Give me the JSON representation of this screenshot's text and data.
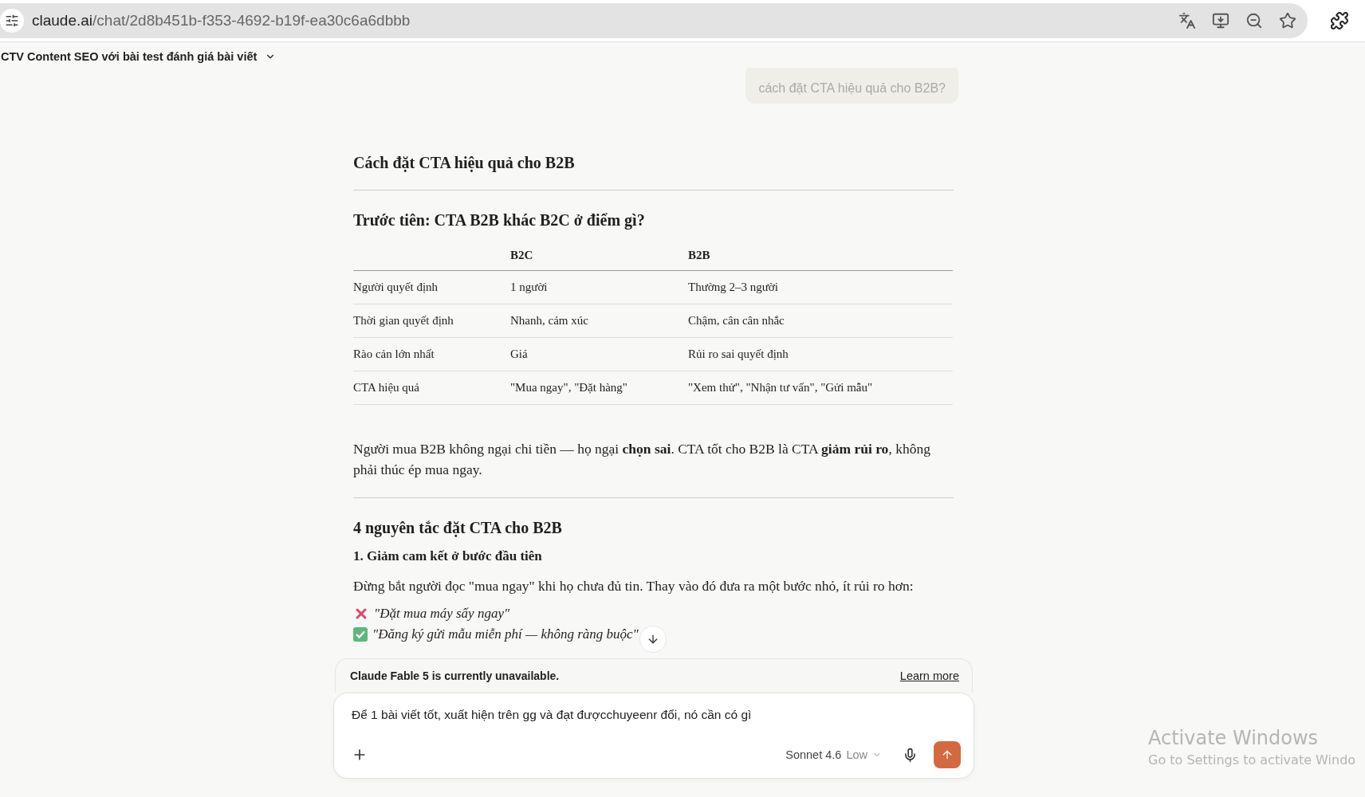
{
  "browser": {
    "url_host": "claude.ai",
    "url_path": "/chat/2d8b451b-f353-4692-b19f-ea30c6a6dbbb"
  },
  "conversation_title": "CTV Content SEO với bài test đánh giá bài viết",
  "user_message": "cách đặt CTA hiệu quả cho B2B?",
  "response": [
    {
      "kind": "h1",
      "text": "Cách đặt CTA hiệu quả cho B2B"
    },
    {
      "kind": "rule"
    },
    {
      "kind": "h2",
      "text": "Trước tiên: CTA B2B khác B2C ở điểm gì?"
    },
    {
      "kind": "table",
      "columns": [
        "",
        "B2C",
        "B2B"
      ],
      "rows": [
        [
          "Người quyết định",
          "1 người",
          "Thường 2–3 người"
        ],
        [
          "Thời gian quyết định",
          "Nhanh, cảm xúc",
          "Chậm, cân cân nhắc"
        ],
        [
          "Rào cản lớn nhất",
          "Giá",
          "Rủi ro sai quyết định"
        ],
        [
          "CTA hiệu quả",
          "\"Mua ngay\", \"Đặt hàng\"",
          "\"Xem thử\", \"Nhận tư vấn\", \"Gửi mẫu\""
        ]
      ]
    },
    {
      "kind": "paragraph",
      "text": "Người mua B2B không ngại chi tiền — họ ngại **chọn sai**. CTA tốt cho B2B là CTA **giảm rủi ro**, không phải thúc ép mua ngay."
    },
    {
      "kind": "rule"
    },
    {
      "kind": "h2",
      "text": "4 nguyên tắc đặt CTA cho B2B"
    },
    {
      "kind": "h3",
      "text": "1. Giảm cam kết ở bước đầu tiên"
    },
    {
      "kind": "paragraph",
      "text": "Đừng bắt người đọc \"mua ngay\" khi họ chưa đủ tin. Thay vào đó đưa ra một bước nhỏ, ít rủi ro hơn:"
    },
    {
      "kind": "example",
      "good": false,
      "text": "\"Đặt mua máy sấy ngay\""
    },
    {
      "kind": "example",
      "good": true,
      "text": "\"Đăng ký gửi mẫu miễn phí — không ràng buộc\""
    }
  ],
  "notice": {
    "text": "Claude Fable 5 is currently unavailable.",
    "link": "Learn more"
  },
  "composer": {
    "value": "Để 1 bài viết tốt, xuất hiện trên gg và đạt đượcchuyeenr đổi, nó cần có gì",
    "model": "Sonnet 4.6",
    "effort": "Low"
  },
  "os_watermark": {
    "title": "Activate Windows",
    "subtitle": "Go to Settings to activate Windo"
  }
}
